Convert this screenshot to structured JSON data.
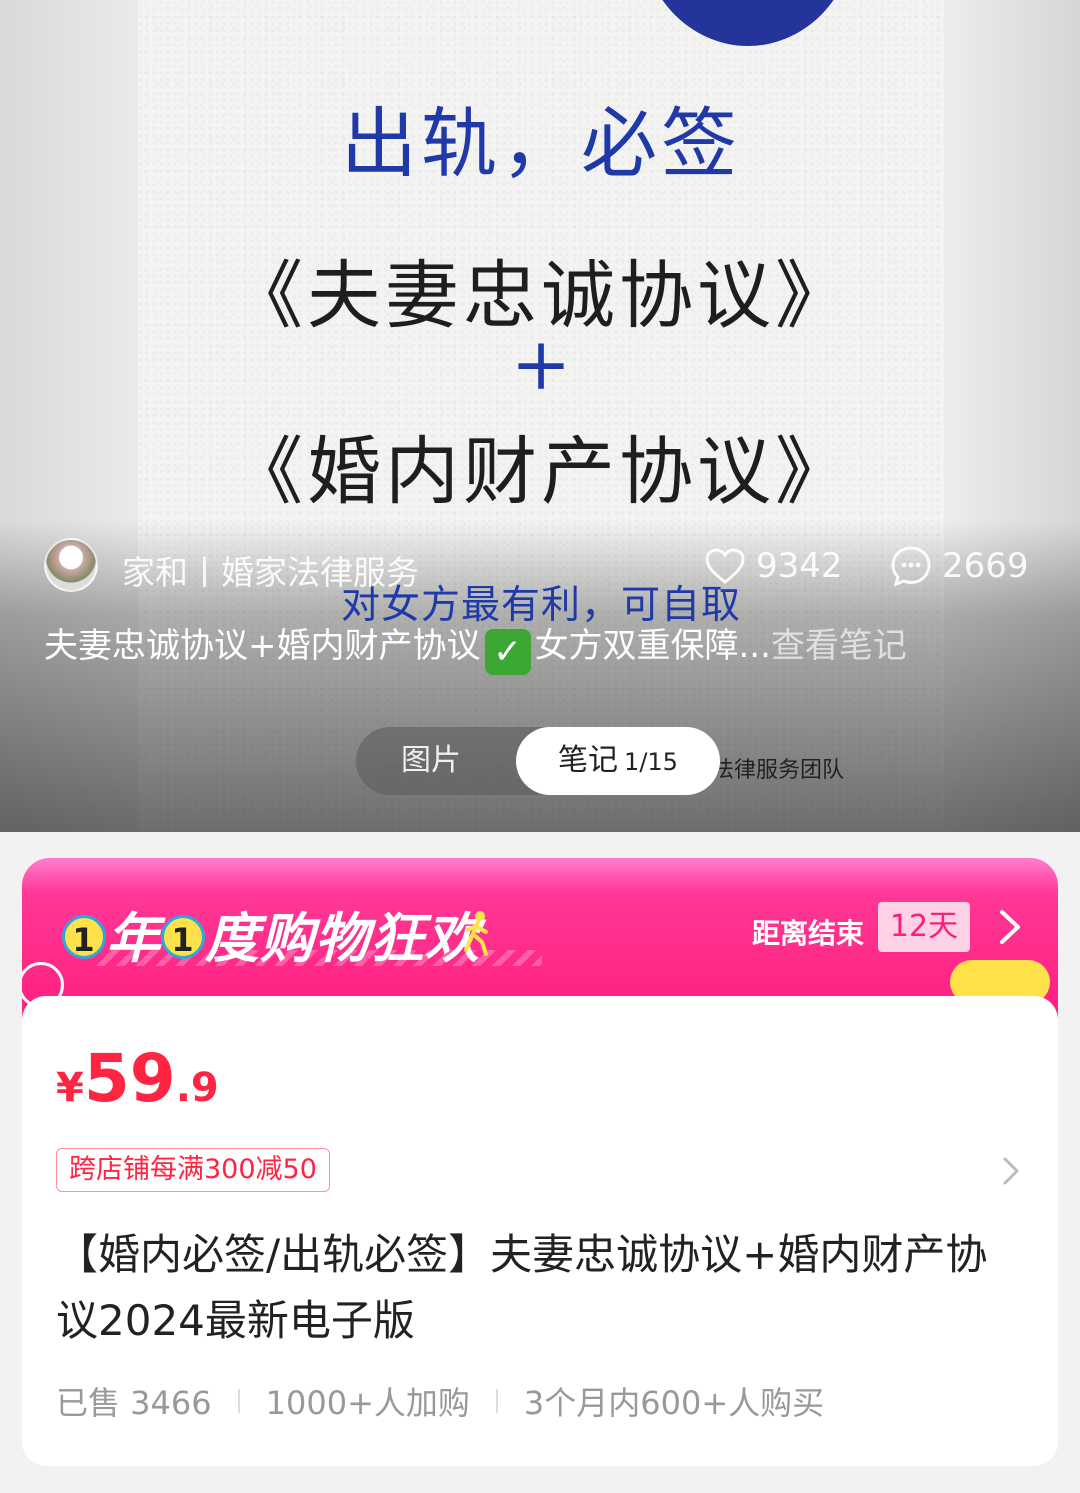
{
  "poster": {
    "line1": "出轨，必签",
    "line2": "《夫妻忠诚协议》",
    "line3": "+",
    "line4": "《婚内财产协议》",
    "line5": "对女方最有利，可自取",
    "team": "口法律服务团队"
  },
  "note": {
    "author": "家和丨婚家法律服务",
    "likes": "9342",
    "comments": "2669",
    "desc_part1": "夫妻忠诚协议+婚内财产协议",
    "desc_part2": "女方双重保障...",
    "view_more": "查看笔记"
  },
  "toggle": {
    "pictures": "图片",
    "notes": "笔记",
    "notes_count": "1/15"
  },
  "promo": {
    "badge1": "1",
    "word1": "年",
    "badge2": "1",
    "word2": "度购物狂欢",
    "countdown_label": "距离结束",
    "countdown_value": "12天",
    "colors": {
      "bg": "#ff1f7e",
      "badge": "#ffe14a"
    }
  },
  "product": {
    "price_symbol": "¥",
    "price_int": "59",
    "price_dec": ".9",
    "coupon": "跨店铺每满300减50",
    "title": "【婚内必签/出轨必签】夫妻忠诚协议+婚内财产协议2024最新电子版",
    "sold": "已售 3466",
    "carted": "1000+人加购",
    "bought": "3个月内600+人购买",
    "accent": "#ff2442"
  }
}
